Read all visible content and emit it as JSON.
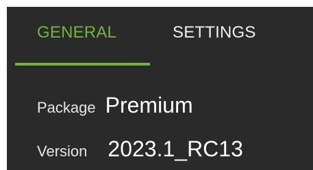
{
  "tabs": {
    "general_label": "GENERAL",
    "settings_label": "SETTINGS",
    "active": "GENERAL"
  },
  "info": {
    "package_label": "Package",
    "package_value": "Premium",
    "version_label": "Version",
    "version_value": "2023.1_RC13"
  },
  "colors": {
    "background": "#2a2a2a",
    "accent": "#74b43c",
    "text": "#ffffff"
  }
}
